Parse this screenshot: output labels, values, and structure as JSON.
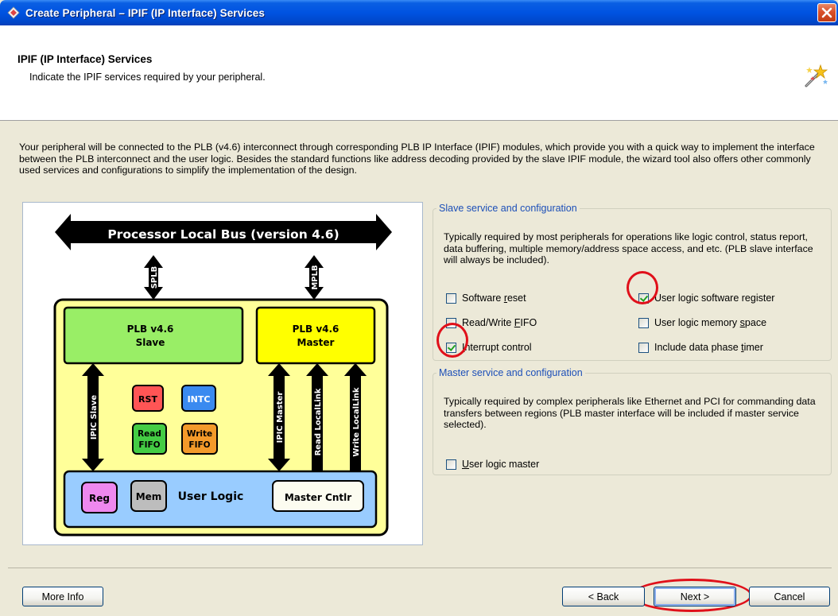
{
  "window": {
    "title": "Create Peripheral – IPIF (IP Interface) Services"
  },
  "header": {
    "title": "IPIF (IP Interface) Services",
    "subtitle": "Indicate the IPIF services required by your peripheral."
  },
  "intro_text": "Your peripheral will be connected to the PLB (v4.6) interconnect through corresponding PLB IP Interface (IPIF) modules, which provide you with a quick way to implement the interface between the PLB interconnect and the user logic. Besides the standard functions like address decoding provided by the slave IPIF module, the wizard tool also offers other commonly used services and configurations to simplify the implementation of the design.",
  "diagram": {
    "bus_label": "Processor Local Bus (version 4.6)",
    "splb": "SPLB",
    "mplb": "MPLB",
    "slave_line1": "PLB v4.6",
    "slave_line2": "Slave",
    "master_line1": "PLB v4.6",
    "master_line2": "Master",
    "rst": "RST",
    "intc": "INTC",
    "read_fifo_1": "Read",
    "read_fifo_2": "FIFO",
    "write_fifo_1": "Write",
    "write_fifo_2": "FIFO",
    "ipic_slave": "IPIC Slave",
    "ipic_master": "IPIC Master",
    "read_locallink": "Read LocalLink",
    "write_locallink": "Write LocalLink",
    "reg": "Reg",
    "mem": "Mem",
    "user_logic": "User Logic",
    "master_cntlr": "Master Cntlr"
  },
  "slave_group": {
    "legend": "Slave service and configuration",
    "description": "Typically required by most peripherals for operations like logic control, status report, data buffering, multiple memory/address space access, and etc. (PLB slave interface will always be included).",
    "options": [
      {
        "label_pre": "Software ",
        "label_key": "r",
        "label_post": "eset",
        "checked": false
      },
      {
        "label_pre": "User logic software register",
        "label_key": "",
        "label_post": "",
        "checked": true
      },
      {
        "label_pre": "Read/Write ",
        "label_key": "F",
        "label_post": "IFO",
        "checked": false
      },
      {
        "label_pre": "User logic memory ",
        "label_key": "s",
        "label_post": "pace",
        "checked": false
      },
      {
        "label_pre": "",
        "label_key": "I",
        "label_post": "nterrupt control",
        "checked": true
      },
      {
        "label_pre": "Include data phase ",
        "label_key": "t",
        "label_post": "imer",
        "checked": false
      }
    ]
  },
  "master_group": {
    "legend": "Master service and configuration",
    "description": "Typically required by complex peripherals like Ethernet and PCI for commanding data transfers between regions (PLB master interface will be included if master service selected).",
    "options": [
      {
        "label_pre": "",
        "label_key": "U",
        "label_post": "ser logic master",
        "checked": false
      }
    ]
  },
  "buttons": {
    "more_info": "More Info",
    "back": "< Back",
    "next": "Next >",
    "cancel": "Cancel"
  },
  "colors": {
    "titlebar": "#0053e1",
    "slave_block": "#99ee66",
    "master_block": "#ffff00",
    "ipif_container": "#ffff99",
    "user_logic": "#99ccff",
    "highlight": "#e0101a"
  }
}
